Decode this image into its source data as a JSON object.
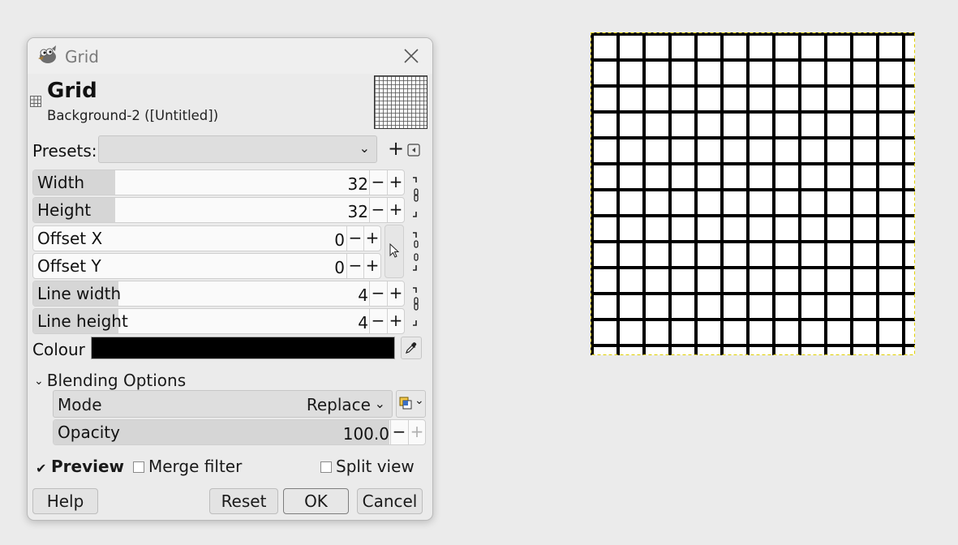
{
  "dialog": {
    "title": "Grid",
    "header_title": "Grid",
    "header_subtitle": "Background-2 ([Untitled])"
  },
  "presets": {
    "label": "Presets:",
    "value": "",
    "add_label": "+"
  },
  "params": {
    "width": {
      "label": "Width",
      "value": "32",
      "fill": 0.22
    },
    "height": {
      "label": "Height",
      "value": "32",
      "fill": 0.22
    },
    "offset_x": {
      "label": "Offset X",
      "value": "0",
      "fill": 0.0
    },
    "offset_y": {
      "label": "Offset Y",
      "value": "0",
      "fill": 0.0
    },
    "line_width": {
      "label": "Line width",
      "value": "4",
      "fill": 0.23
    },
    "line_height": {
      "label": "Line height",
      "value": "4",
      "fill": 0.23
    }
  },
  "spin": {
    "minus": "−",
    "plus": "+"
  },
  "colour": {
    "label": "Colour",
    "value": "#000000"
  },
  "blending": {
    "expander_label": "Blending Options",
    "mode_label": "Mode",
    "mode_value": "Replace",
    "opacity_label": "Opacity",
    "opacity_value": "100.0",
    "opacity_fill": 1.0
  },
  "options": {
    "preview_label": "Preview",
    "preview_checked": true,
    "merge_label": "Merge filter",
    "merge_checked": false,
    "split_label": "Split view",
    "split_checked": false
  },
  "buttons": {
    "help": "Help",
    "reset": "Reset",
    "ok": "OK",
    "cancel": "Cancel"
  },
  "canvas": {
    "grid_spacing": 32,
    "line_width": 4,
    "line_colour": "#000000",
    "background": "#ffffff"
  }
}
